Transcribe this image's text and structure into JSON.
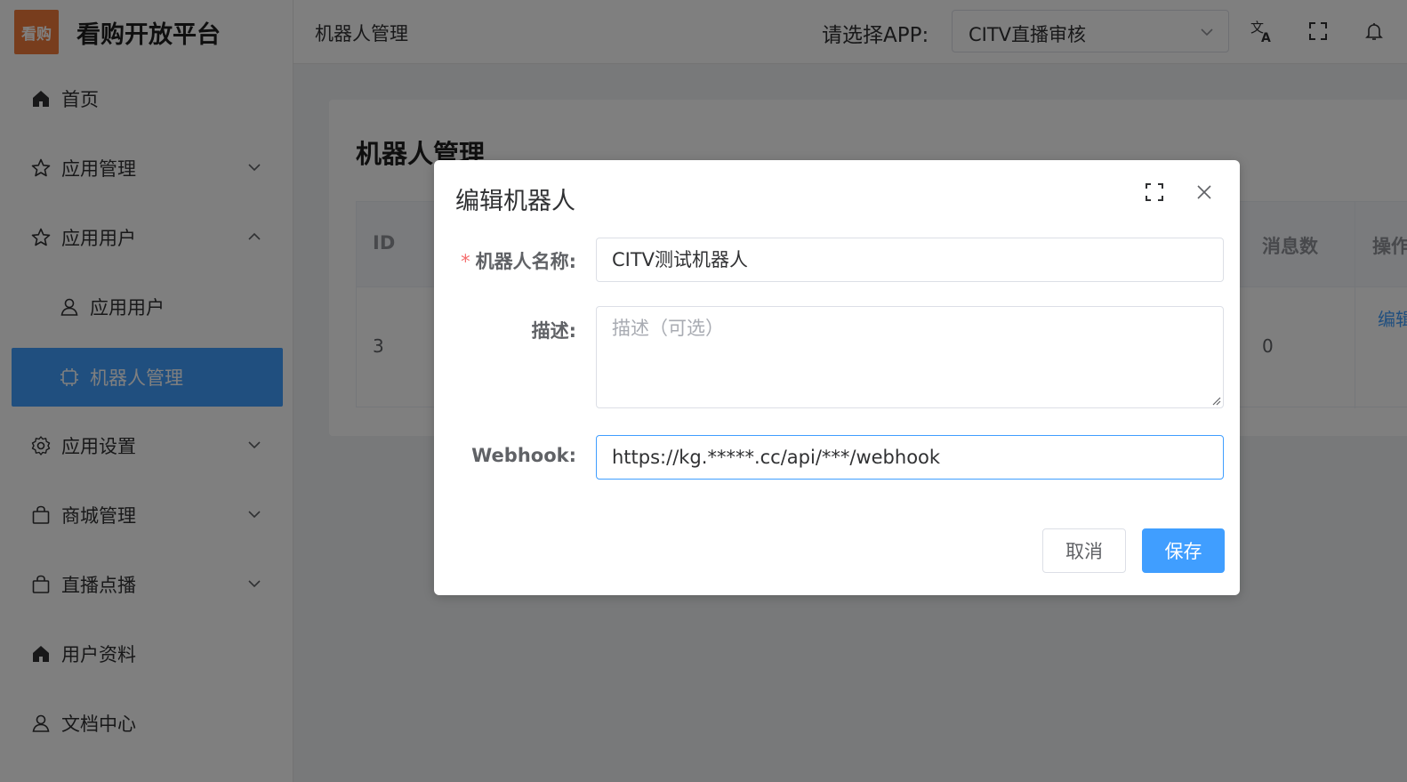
{
  "brand": {
    "logo_text": "看购",
    "name": "看购开放平台",
    "logo_color": "#f07a3a"
  },
  "header": {
    "breadcrumb": "机器人管理",
    "app_label": "请选择APP:",
    "app_selected": "CITV直播审核",
    "icons": [
      "translate-icon",
      "fullscreen-icon",
      "bell-icon"
    ]
  },
  "sidebar": {
    "items": [
      {
        "label": "首页",
        "icon": "home-icon"
      },
      {
        "label": "应用管理",
        "icon": "star-icon",
        "expandable": true,
        "expanded": false
      },
      {
        "label": "应用用户",
        "icon": "star-icon",
        "expandable": true,
        "expanded": true
      },
      {
        "label": "应用用户",
        "icon": "user-icon",
        "sub": true
      },
      {
        "label": "机器人管理",
        "icon": "chip-icon",
        "sub": true,
        "active": true
      },
      {
        "label": "应用设置",
        "icon": "gear-icon",
        "expandable": true,
        "expanded": false
      },
      {
        "label": "商城管理",
        "icon": "bag-icon",
        "expandable": true,
        "expanded": false
      },
      {
        "label": "直播点播",
        "icon": "bag-icon",
        "expandable": true,
        "expanded": false
      },
      {
        "label": "用户资料",
        "icon": "home-icon"
      },
      {
        "label": "文档中心",
        "icon": "user-icon"
      }
    ],
    "active_color": "#409eff"
  },
  "page": {
    "title": "机器人管理",
    "table": {
      "headers": {
        "id": "ID",
        "messages": "消息数",
        "actions": "操作"
      },
      "row": {
        "id": "3",
        "messages": "0",
        "action_partial": "编辑"
      }
    }
  },
  "dialog": {
    "title": "编辑机器人",
    "fields": {
      "name": {
        "label": "机器人名称:",
        "value": "CITV测试机器人",
        "required": true
      },
      "description": {
        "label": "描述:",
        "value": "",
        "placeholder": "描述（可选）"
      },
      "webhook": {
        "label": "Webhook:",
        "value": "https://kg.*****.cc/api/***/webhook"
      }
    },
    "buttons": {
      "cancel": "取消",
      "save": "保存"
    },
    "accent": "#409eff"
  }
}
